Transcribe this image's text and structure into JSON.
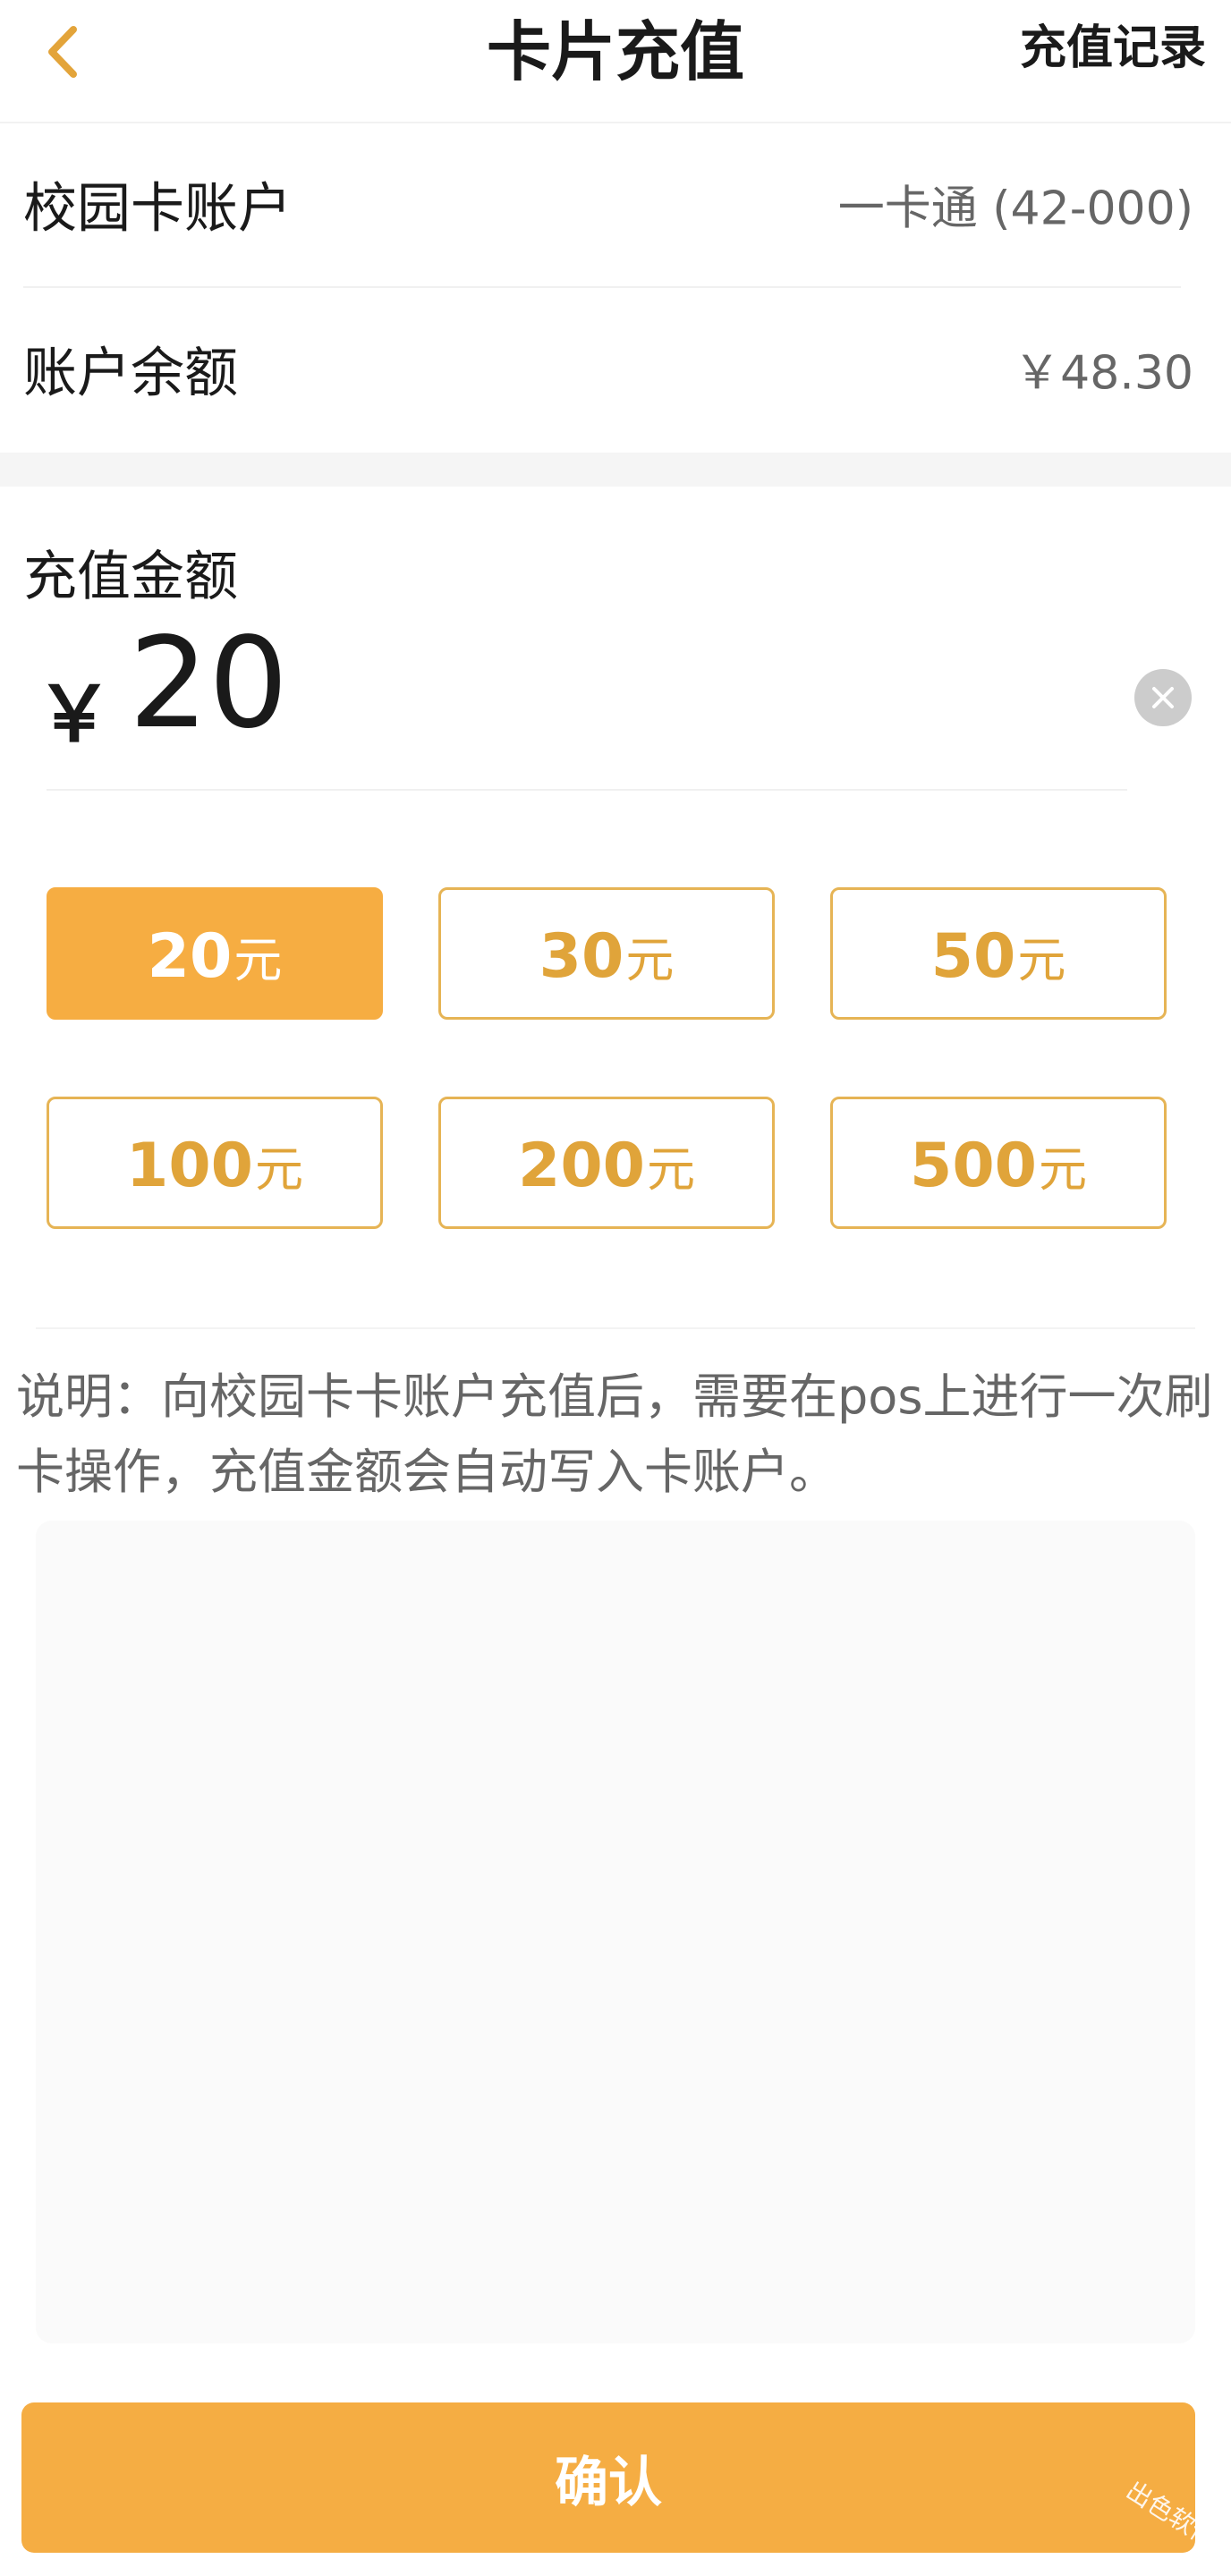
{
  "header": {
    "title": "卡片充值",
    "records_label": "充值记录"
  },
  "account": {
    "card_label": "校园卡账户",
    "card_value": "一卡通 (42-000)",
    "balance_label": "账户余额",
    "balance_value": "￥48.30"
  },
  "recharge": {
    "title": "充值金额",
    "currency_symbol": "￥",
    "amount": "20",
    "unit": "元",
    "options": [
      {
        "value": "20",
        "selected": true
      },
      {
        "value": "30",
        "selected": false
      },
      {
        "value": "50",
        "selected": false
      },
      {
        "value": "100",
        "selected": false
      },
      {
        "value": "200",
        "selected": false
      },
      {
        "value": "500",
        "selected": false
      }
    ]
  },
  "note": {
    "text": "说明：向校园卡卡账户充值后，需要在pos上进行一次刷卡操作，充值金额会自动写入卡账户。"
  },
  "confirm": {
    "label": "确认"
  },
  "watermark": {
    "text": "出色软件"
  },
  "colors": {
    "accent": "#f5ad43",
    "accent_border": "#e6b455",
    "accent_text": "#e0a43a"
  },
  "icons": {
    "back": "chevron-left-icon",
    "clear": "clear-circle-icon"
  }
}
